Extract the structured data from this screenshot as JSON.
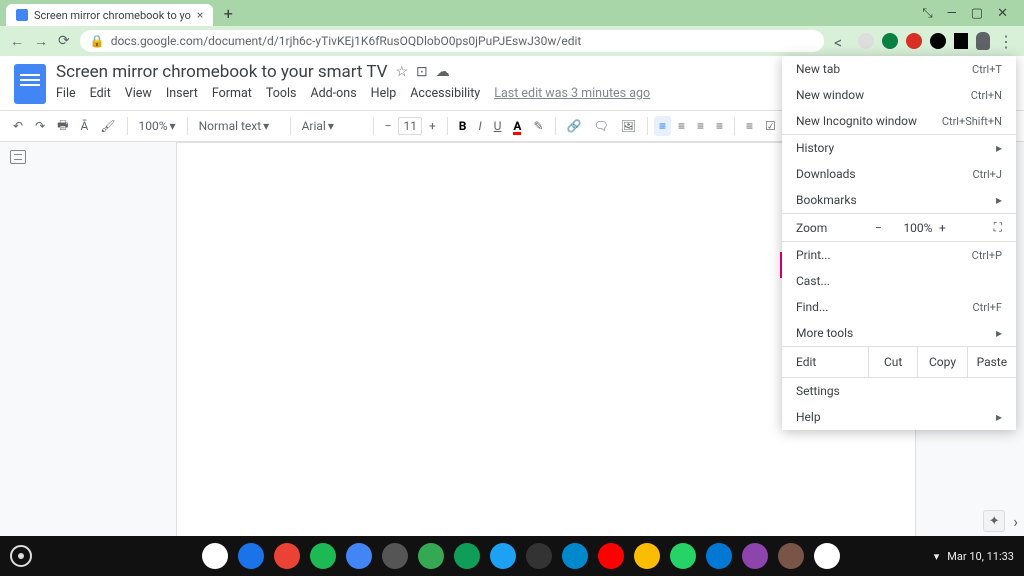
{
  "browser": {
    "tab_title": "Screen mirror chromebook to yo",
    "url": "docs.google.com/document/d/1rjh6c-yTivKEj1K6fRusOQDlobO0ps0jPuPJEswJ30w/edit"
  },
  "docs": {
    "title": "Screen mirror chromebook to your smart TV",
    "menus": [
      "File",
      "Edit",
      "View",
      "Insert",
      "Format",
      "Tools",
      "Add-ons",
      "Help",
      "Accessibility"
    ],
    "last_edit": "Last edit was 3 minutes ago",
    "zoom": "100%",
    "style": "Normal text",
    "font": "Arial",
    "font_size": "11"
  },
  "toolbar": {
    "bold": "B",
    "italic": "I",
    "underline": "U",
    "color": "A",
    "minus": "−",
    "plus": "+"
  },
  "menu": {
    "new_tab": {
      "label": "New tab",
      "sc": "Ctrl+T"
    },
    "new_window": {
      "label": "New window",
      "sc": "Ctrl+N"
    },
    "new_incognito": {
      "label": "New Incognito window",
      "sc": "Ctrl+Shift+N"
    },
    "history": "History",
    "downloads": {
      "label": "Downloads",
      "sc": "Ctrl+J"
    },
    "bookmarks": "Bookmarks",
    "zoom_label": "Zoom",
    "zoom_value": "100%",
    "zoom_minus": "−",
    "zoom_plus": "+",
    "print": {
      "label": "Print...",
      "sc": "Ctrl+P"
    },
    "cast": "Cast...",
    "find": {
      "label": "Find...",
      "sc": "Ctrl+F"
    },
    "more_tools": "More tools",
    "edit": "Edit",
    "cut": "Cut",
    "copy": "Copy",
    "paste": "Paste",
    "settings": "Settings",
    "help": "Help"
  },
  "shelf": {
    "date": "Mar 10, 11:33",
    "app_colors": [
      "#fff",
      "#1a73e8",
      "#ea4335",
      "#1db954",
      "#4285f4",
      "#555",
      "#34a853",
      "#0f9d58",
      "#1da1f2",
      "#333",
      "#0088cc",
      "#ff0000",
      "#fbbc04",
      "#25d366",
      "#0078d4",
      "#8e44ad",
      "#795548",
      "#fff"
    ]
  }
}
